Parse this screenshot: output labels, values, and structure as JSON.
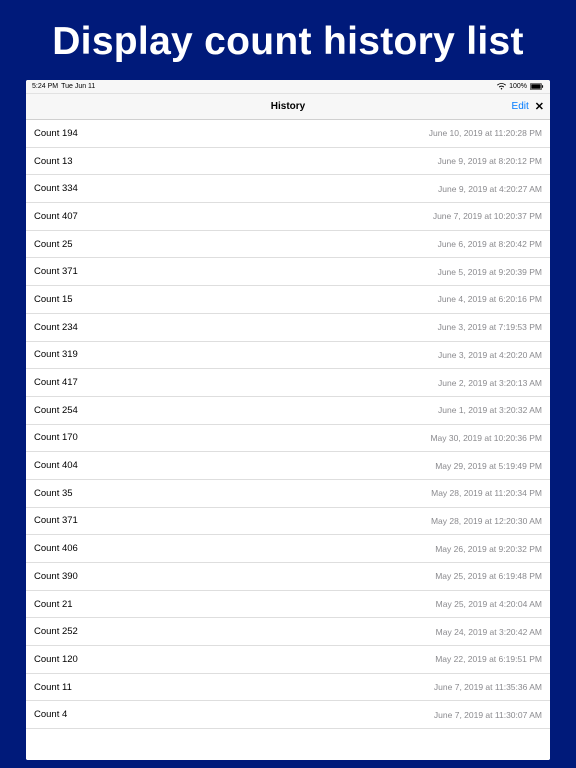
{
  "page_title": "Display count history list",
  "status_bar": {
    "time": "5:24 PM",
    "date": "Tue Jun 11",
    "battery_pct": "100%"
  },
  "navbar": {
    "title": "History",
    "edit_label": "Edit",
    "close_glyph": "✕"
  },
  "rows": [
    {
      "label": "Count 194",
      "time": "June 10, 2019 at 11:20:28 PM"
    },
    {
      "label": "Count  13",
      "time": "June 9, 2019 at 8:20:12 PM"
    },
    {
      "label": "Count 334",
      "time": "June 9, 2019 at 4:20:27 AM"
    },
    {
      "label": "Count 407",
      "time": "June 7, 2019 at 10:20:37 PM"
    },
    {
      "label": "Count  25",
      "time": "June 6, 2019 at 8:20:42 PM"
    },
    {
      "label": "Count 371",
      "time": "June 5, 2019 at 9:20:39 PM"
    },
    {
      "label": "Count  15",
      "time": "June 4, 2019 at 6:20:16 PM"
    },
    {
      "label": "Count 234",
      "time": "June 3, 2019 at 7:19:53 PM"
    },
    {
      "label": "Count 319",
      "time": "June 3, 2019 at 4:20:20 AM"
    },
    {
      "label": "Count 417",
      "time": "June 2, 2019 at 3:20:13 AM"
    },
    {
      "label": "Count 254",
      "time": "June 1, 2019 at 3:20:32 AM"
    },
    {
      "label": "Count 170",
      "time": "May 30, 2019 at 10:20:36 PM"
    },
    {
      "label": "Count 404",
      "time": "May 29, 2019 at 5:19:49 PM"
    },
    {
      "label": "Count  35",
      "time": "May 28, 2019 at 11:20:34 PM"
    },
    {
      "label": "Count 371",
      "time": "May 28, 2019 at 12:20:30 AM"
    },
    {
      "label": "Count 406",
      "time": "May 26, 2019 at 9:20:32 PM"
    },
    {
      "label": "Count 390",
      "time": "May 25, 2019 at 6:19:48 PM"
    },
    {
      "label": "Count  21",
      "time": "May 25, 2019 at 4:20:04 AM"
    },
    {
      "label": "Count 252",
      "time": "May 24, 2019 at 3:20:42 AM"
    },
    {
      "label": "Count 120",
      "time": "May 22, 2019 at 6:19:51 PM"
    },
    {
      "label": "Count  11",
      "time": "June 7, 2019 at 11:35:36 AM"
    },
    {
      "label": "Count   4",
      "time": "June 7, 2019 at 11:30:07 AM"
    }
  ]
}
